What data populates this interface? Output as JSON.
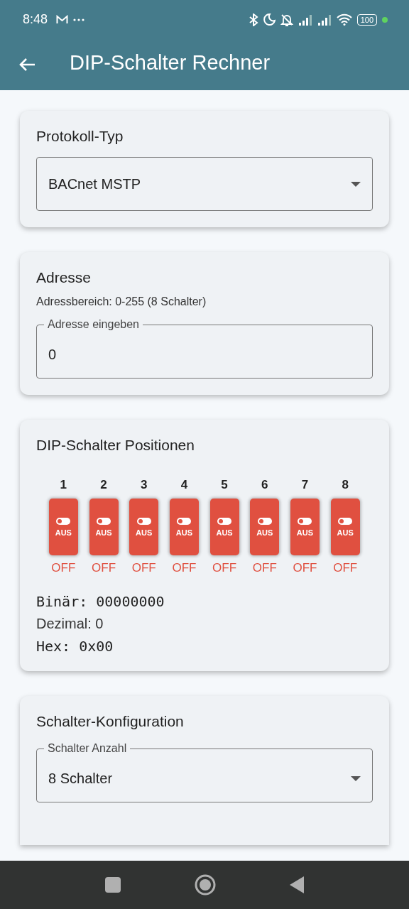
{
  "status_bar": {
    "time": "8:48",
    "battery": "100"
  },
  "app_bar": {
    "title": "DIP-Schalter Rechner"
  },
  "protocol_card": {
    "title": "Protokoll-Typ",
    "dropdown": {
      "value": "BACnet MSTP"
    }
  },
  "address_card": {
    "title": "Adresse",
    "hint": "Adressbereich: 0-255 (8 Schalter)",
    "field": {
      "label": "Adresse eingeben",
      "value": "0"
    }
  },
  "switches_card": {
    "title": "DIP-Schalter Positionen",
    "switches": [
      {
        "number": "1",
        "label": "AUS",
        "state": "OFF",
        "on": false
      },
      {
        "number": "2",
        "label": "AUS",
        "state": "OFF",
        "on": false
      },
      {
        "number": "3",
        "label": "AUS",
        "state": "OFF",
        "on": false
      },
      {
        "number": "4",
        "label": "AUS",
        "state": "OFF",
        "on": false
      },
      {
        "number": "5",
        "label": "AUS",
        "state": "OFF",
        "on": false
      },
      {
        "number": "6",
        "label": "AUS",
        "state": "OFF",
        "on": false
      },
      {
        "number": "7",
        "label": "AUS",
        "state": "OFF",
        "on": false
      },
      {
        "number": "8",
        "label": "AUS",
        "state": "OFF",
        "on": false
      }
    ],
    "binary": "Binär: 00000000",
    "decimal": "Dezimal: 0",
    "hex": "Hex: 0x00"
  },
  "config_card": {
    "title": "Schalter-Konfiguration",
    "dropdown": {
      "label": "Schalter Anzahl",
      "value": "8 Schalter"
    }
  }
}
